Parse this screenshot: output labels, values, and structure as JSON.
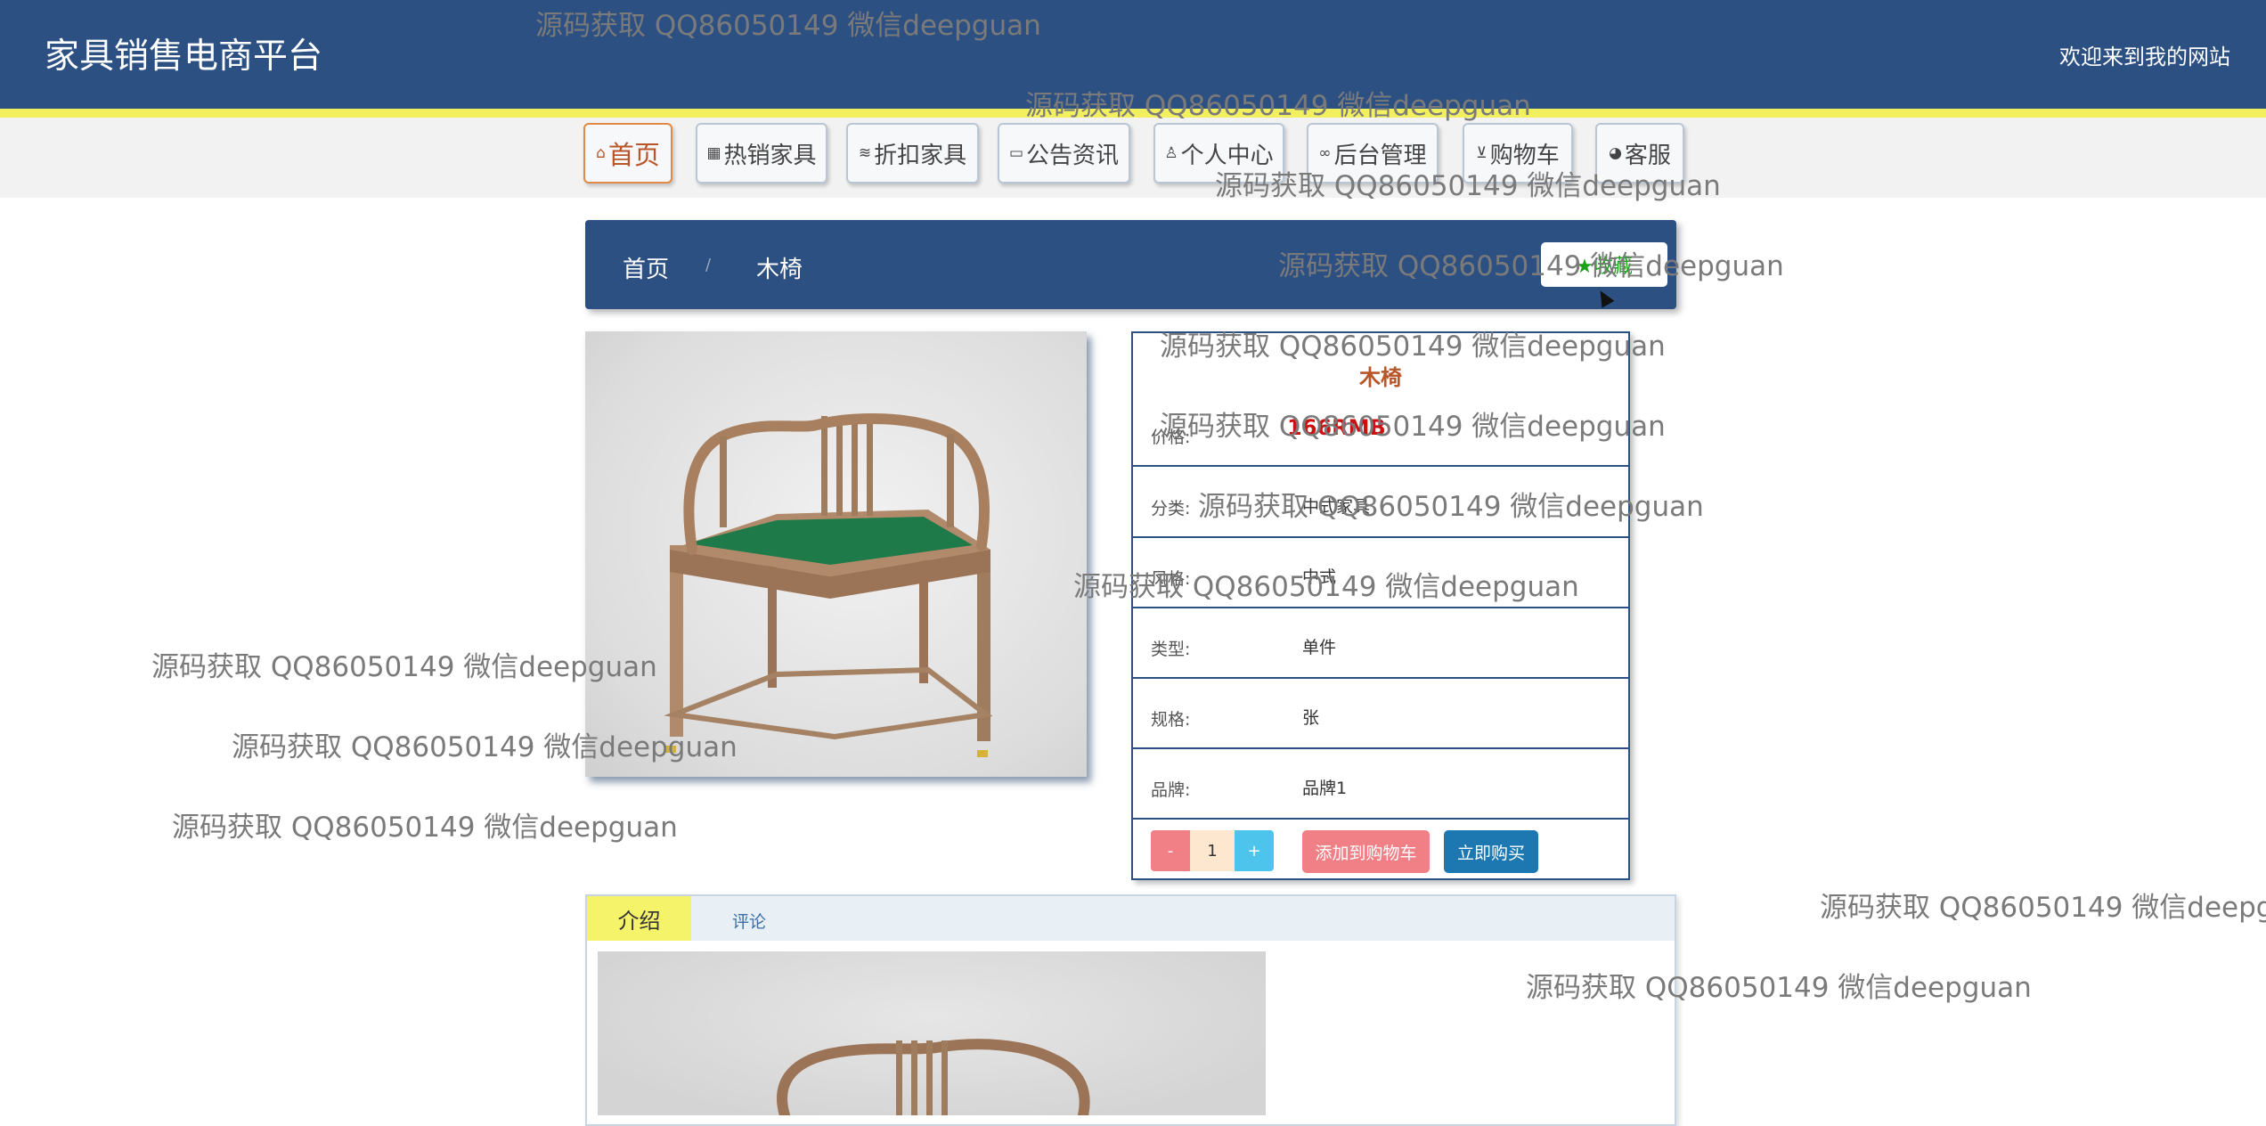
{
  "header": {
    "site_title": "家具销售电商平台",
    "welcome": "欢迎来到我的网站"
  },
  "nav": [
    {
      "icon": "home-icon",
      "glyph": "⌂",
      "label": "首页"
    },
    {
      "icon": "grid-icon",
      "glyph": "▦",
      "label": "热销家具"
    },
    {
      "icon": "layers-icon",
      "glyph": "≋",
      "label": "折扣家具"
    },
    {
      "icon": "note-icon",
      "glyph": "▭",
      "label": "公告资讯"
    },
    {
      "icon": "user-icon",
      "glyph": "♙",
      "label": "个人中心"
    },
    {
      "icon": "link-icon",
      "glyph": "∞",
      "label": "后台管理"
    },
    {
      "icon": "cart-icon",
      "glyph": "⊻",
      "label": "购物车"
    },
    {
      "icon": "service-icon",
      "glyph": "◕",
      "label": "客服"
    }
  ],
  "breadcrumb": {
    "home": "首页",
    "separator": "/",
    "current": "木椅",
    "favorite_label": "★收藏"
  },
  "product": {
    "name": "木椅",
    "price_label": "价格:",
    "price": "166RMB",
    "fields": [
      {
        "label": "分类:",
        "value": "中式家具"
      },
      {
        "label": "风格:",
        "value": "中式"
      },
      {
        "label": "类型:",
        "value": "单件"
      },
      {
        "label": "规格:",
        "value": "张"
      },
      {
        "label": "品牌:",
        "value": "品牌1"
      }
    ],
    "quantity": "1",
    "minus": "-",
    "plus": "+",
    "add_to_cart": "添加到购物车",
    "buy_now": "立即购买"
  },
  "tabs": {
    "intro": "介绍",
    "comments": "评论"
  },
  "watermark": "源码获取 QQ86050149 微信deepguan",
  "colors": {
    "header_bg": "#2d5083",
    "header_stripe": "#f3f060",
    "price": "#cc1111",
    "favorite": "#1aa01a"
  }
}
